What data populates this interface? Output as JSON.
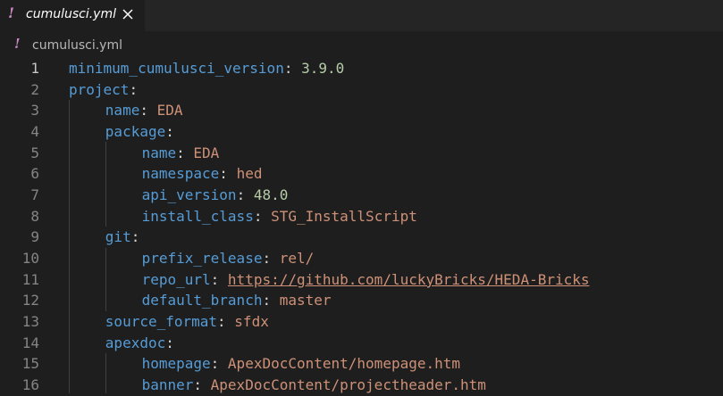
{
  "tab": {
    "icon": "!",
    "label": "cumulusci.yml",
    "close_icon": "close-icon"
  },
  "breadcrumb": {
    "icon": "!",
    "label": "cumulusci.yml"
  },
  "colors": {
    "key": "#569cd6",
    "string": "#ce9178",
    "number": "#b5cea8",
    "punctuation": "#d4d4d4",
    "yaml_icon": "#c586c0"
  },
  "lines": [
    {
      "n": "1",
      "indent": 0,
      "key": "minimum_cumulusci_version",
      "value": "3.9.0",
      "vtype": "num"
    },
    {
      "n": "2",
      "indent": 0,
      "key": "project",
      "value": "",
      "vtype": ""
    },
    {
      "n": "3",
      "indent": 1,
      "key": "name",
      "value": "EDA",
      "vtype": "str"
    },
    {
      "n": "4",
      "indent": 1,
      "key": "package",
      "value": "",
      "vtype": ""
    },
    {
      "n": "5",
      "indent": 2,
      "key": "name",
      "value": "EDA",
      "vtype": "str"
    },
    {
      "n": "6",
      "indent": 2,
      "key": "namespace",
      "value": "hed",
      "vtype": "str"
    },
    {
      "n": "7",
      "indent": 2,
      "key": "api_version",
      "value": "48.0",
      "vtype": "num"
    },
    {
      "n": "8",
      "indent": 2,
      "key": "install_class",
      "value": "STG_InstallScript",
      "vtype": "str"
    },
    {
      "n": "9",
      "indent": 1,
      "key": "git",
      "value": "",
      "vtype": ""
    },
    {
      "n": "10",
      "indent": 2,
      "key": "prefix_release",
      "value": "rel/",
      "vtype": "str"
    },
    {
      "n": "11",
      "indent": 2,
      "key": "repo_url",
      "value": "https://github.com/luckyBricks/HEDA-Bricks",
      "vtype": "url"
    },
    {
      "n": "12",
      "indent": 2,
      "key": "default_branch",
      "value": "master",
      "vtype": "str"
    },
    {
      "n": "13",
      "indent": 1,
      "key": "source_format",
      "value": "sfdx",
      "vtype": "str"
    },
    {
      "n": "14",
      "indent": 1,
      "key": "apexdoc",
      "value": "",
      "vtype": ""
    },
    {
      "n": "15",
      "indent": 2,
      "key": "homepage",
      "value": "ApexDocContent/homepage.htm",
      "vtype": "str"
    },
    {
      "n": "16",
      "indent": 2,
      "key": "banner",
      "value": "ApexDocContent/projectheader.htm",
      "vtype": "str"
    }
  ]
}
